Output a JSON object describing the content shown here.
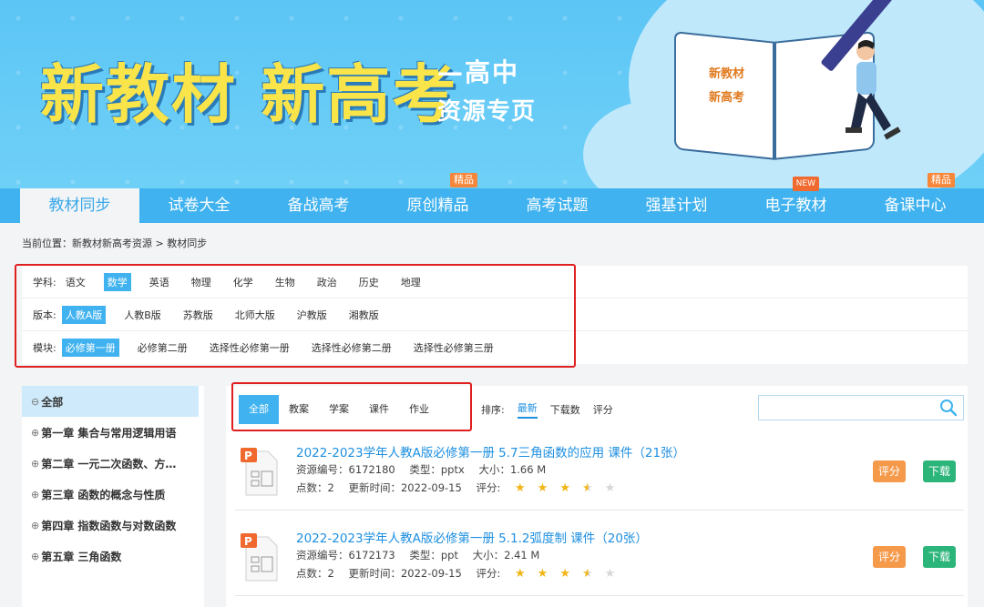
{
  "banner": {
    "title": "新教材 新高考",
    "subtitle_1": "—高中",
    "subtitle_2": "资源专页",
    "book_text_1": "新教材",
    "book_text_2": "新高考"
  },
  "nav": {
    "items": [
      {
        "label": "教材同步",
        "active": true,
        "badge": ""
      },
      {
        "label": "试卷大全",
        "badge": ""
      },
      {
        "label": "备战高考",
        "badge": ""
      },
      {
        "label": "原创精品",
        "badge": "精品"
      },
      {
        "label": "高考试题",
        "badge": ""
      },
      {
        "label": "强基计划",
        "badge": ""
      },
      {
        "label": "电子教材",
        "badge": "NEW"
      },
      {
        "label": "备课中心",
        "badge": "精品"
      }
    ]
  },
  "breadcrumb": "当前位置：新教材新高考资源 > 教材同步",
  "filters": {
    "subject": {
      "label": "学科:",
      "options": [
        "语文",
        "数学",
        "英语",
        "物理",
        "化学",
        "生物",
        "政治",
        "历史",
        "地理"
      ],
      "selected": "数学"
    },
    "edition": {
      "label": "版本:",
      "options": [
        "人教A版",
        "人教B版",
        "苏教版",
        "北师大版",
        "沪教版",
        "湘教版"
      ],
      "selected": "人教A版"
    },
    "module": {
      "label": "模块:",
      "options": [
        "必修第一册",
        "必修第二册",
        "选择性必修第一册",
        "选择性必修第二册",
        "选择性必修第三册"
      ],
      "selected": "必修第一册"
    }
  },
  "sidebar": {
    "items": [
      {
        "icon": "⊖",
        "label": "全部",
        "selected": true
      },
      {
        "icon": "⊕",
        "label": "第一章 集合与常用逻辑用语"
      },
      {
        "icon": "⊕",
        "label": "第二章 一元二次函数、方…"
      },
      {
        "icon": "⊕",
        "label": "第三章 函数的概念与性质"
      },
      {
        "icon": "⊕",
        "label": "第四章 指数函数与对数函数"
      },
      {
        "icon": "⊕",
        "label": "第五章 三角函数"
      }
    ]
  },
  "tabs": [
    "全部",
    "教案",
    "学案",
    "课件",
    "作业"
  ],
  "sort": {
    "label": "排序:",
    "options": [
      "最新",
      "下载数",
      "评分"
    ],
    "selected": "最新"
  },
  "search": {
    "placeholder": "",
    "icon": "search-icon"
  },
  "results": [
    {
      "title": "2022-2023学年人教A版必修第一册 5.7三角函数的应用 课件（21张）",
      "id": "资源编号：6172180",
      "type": "类型：pptx",
      "size": "大小：1.66 M",
      "points": "点数：2",
      "updated": "更新时间：2022-09-15",
      "rating_label": "评分:",
      "rating": 3.5,
      "rate_label": "评分",
      "download_label": "下载"
    },
    {
      "title": "2022-2023学年人教A版必修第一册 5.1.2弧度制 课件（20张）",
      "id": "资源编号：6172173",
      "type": "类型：ppt",
      "size": "大小：2.41 M",
      "points": "点数：2",
      "updated": "更新时间：2022-09-15",
      "rating_label": "评分:",
      "rating": 3.5,
      "rate_label": "评分",
      "download_label": "下载"
    }
  ],
  "colors": {
    "nav": "#3fb2ef",
    "link": "#1d8fe0",
    "rate_btn": "#f59a4b",
    "dl_btn": "#2cb57b",
    "highlight_box": "#e02020"
  }
}
